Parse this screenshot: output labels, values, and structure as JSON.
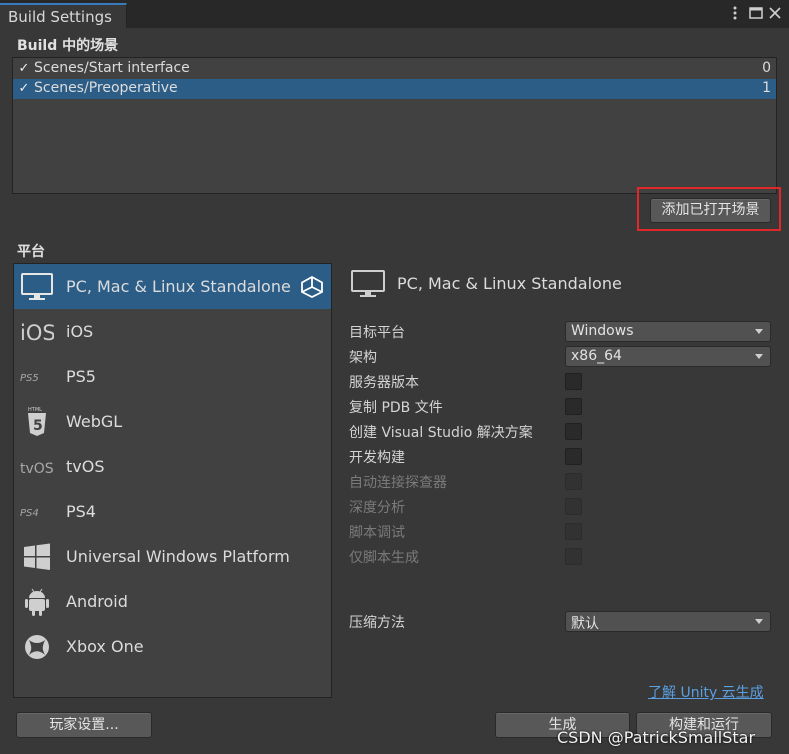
{
  "window": {
    "tab_title": "Build Settings",
    "menu_icon": "kebab-menu-icon",
    "maximize_icon": "maximize-icon",
    "close_icon": "close-icon"
  },
  "scenes": {
    "heading": "Build 中的场景",
    "items": [
      {
        "name": "Scenes/Start interface",
        "index": "0",
        "checked": true,
        "selected": false
      },
      {
        "name": "Scenes/Preoperative",
        "index": "1",
        "checked": true,
        "selected": true
      }
    ],
    "add_open_scenes_label": "添加已打开场景"
  },
  "platform": {
    "heading": "平台",
    "items": [
      {
        "label": "PC, Mac & Linux Standalone",
        "icon": "monitor-icon",
        "selected": true
      },
      {
        "label": "iOS",
        "icon": "ios-icon"
      },
      {
        "label": "PS5",
        "icon": "ps5-icon"
      },
      {
        "label": "WebGL",
        "icon": "html5-icon"
      },
      {
        "label": "tvOS",
        "icon": "tvos-icon"
      },
      {
        "label": "PS4",
        "icon": "ps4-icon"
      },
      {
        "label": "Universal Windows Platform",
        "icon": "windows-icon"
      },
      {
        "label": "Android",
        "icon": "android-icon"
      },
      {
        "label": "Xbox One",
        "icon": "xbox-icon"
      }
    ]
  },
  "settings": {
    "title": "PC, Mac & Linux Standalone",
    "target_platform_label": "目标平台",
    "target_platform_value": "Windows",
    "architecture_label": "架构",
    "architecture_value": "x86_64",
    "server_build_label": "服务器版本",
    "copy_pdb_label": "复制 PDB 文件",
    "create_vs_solution_label": "创建 Visual Studio 解决方案",
    "development_build_label": "开发构建",
    "autoconnect_profiler_label": "自动连接探查器",
    "deep_profiling_label": "深度分析",
    "script_debugging_label": "脚本调试",
    "scripts_only_build_label": "仅脚本生成",
    "compression_label": "压缩方法",
    "compression_value": "默认"
  },
  "footer": {
    "cloud_build_link": "了解 Unity 云生成",
    "player_settings_label": "玩家设置...",
    "build_label": "生成",
    "build_and_run_label": "构建和运行"
  },
  "watermark": "CSDN @PatrickSmallStar",
  "colors": {
    "background": "#383838",
    "selection": "#2c5d87",
    "link": "#5a9fe0",
    "highlight_box": "#e0282a"
  }
}
